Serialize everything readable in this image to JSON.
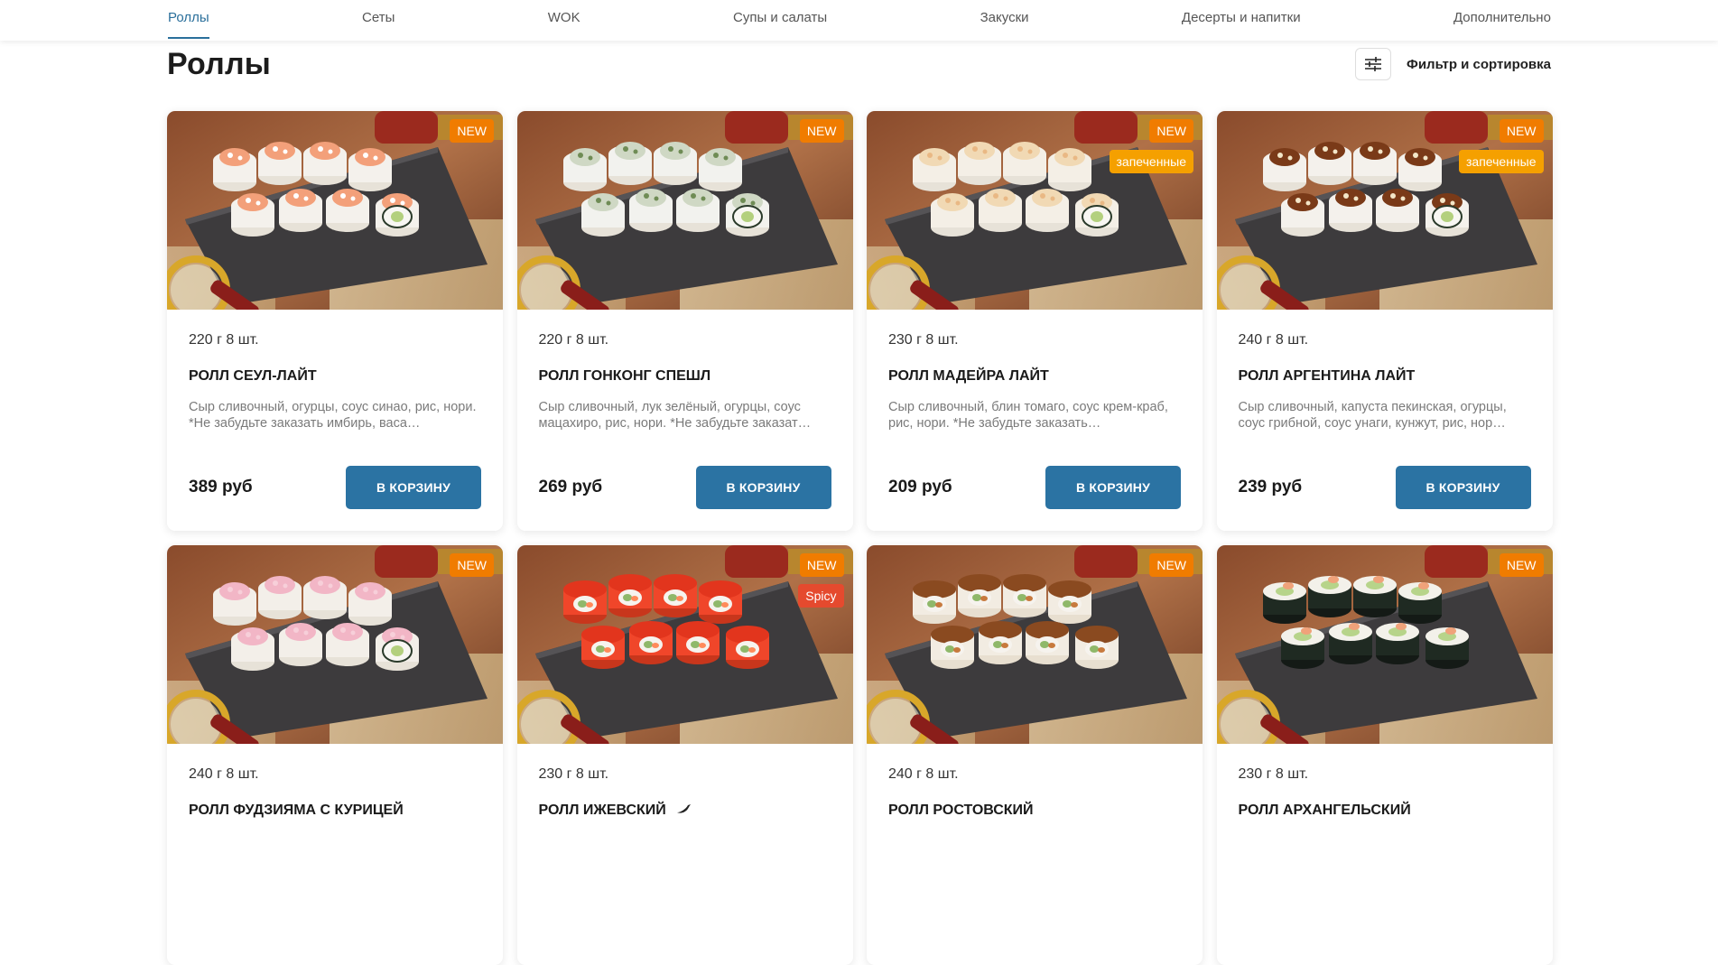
{
  "nav": {
    "items": [
      {
        "label": "Роллы",
        "active": true
      },
      {
        "label": "Сеты"
      },
      {
        "label": "WOK"
      },
      {
        "label": "Супы и салаты"
      },
      {
        "label": "Закуски"
      },
      {
        "label": "Десерты и напитки"
      },
      {
        "label": "Дополнительно"
      }
    ]
  },
  "page": {
    "title": "Роллы",
    "filter_label": "Фильтр и сортировка",
    "filter_icon": "sliders-icon"
  },
  "colors": {
    "accent": "#2b73a3",
    "badge_new": "#f07c00",
    "badge_baked": "#f5a000",
    "badge_spicy": "#e54a2e"
  },
  "products": [
    {
      "weight": "220 г 8 шт.",
      "name": "РОЛЛ СЕУЛ-ЛАЙТ",
      "desc": "Сыр сливочный, огурцы, соус синао, рис, нори. *Не забудьте заказать имбирь, васа…",
      "price": "389 руб",
      "button": "В КОРЗИНУ",
      "badges": [
        "NEW"
      ],
      "topping": "salmon"
    },
    {
      "weight": "220 г 8 шт.",
      "name": "РОЛЛ ГОНКОНГ СПЕШЛ",
      "desc": "Сыр сливочный, лук зелёный, огурцы, соус мацахиро, рис, нори. *Не забудьте заказат…",
      "price": "269 руб",
      "button": "В КОРЗИНУ",
      "badges": [
        "NEW"
      ],
      "topping": "green"
    },
    {
      "weight": "230 г 8 шт.",
      "name": "РОЛЛ МАДЕЙРА ЛАЙТ",
      "desc": "Сыр сливочный, блин томаго, соус крем-краб, рис, нори. *Не забудьте заказать…",
      "price": "209 руб",
      "button": "В КОРЗИНУ",
      "badges": [
        "NEW",
        "запеченные"
      ],
      "topping": "baked"
    },
    {
      "weight": "240 г 8 шт.",
      "name": "РОЛЛ АРГЕНТИНА ЛАЙТ",
      "desc": "Сыр сливочный, капуста пекинская, огурцы, соус грибной, соус унаги, кунжут, рис, нор…",
      "price": "239 руб",
      "button": "В КОРЗИНУ",
      "badges": [
        "NEW",
        "запеченные"
      ],
      "topping": "unagi"
    },
    {
      "weight": "240 г 8 шт.",
      "name": "РОЛЛ ФУДЗИЯМА С КУРИЦЕЙ",
      "desc": "",
      "price": "",
      "button": "",
      "badges": [
        "NEW"
      ],
      "topping": "pink"
    },
    {
      "weight": "230 г 8 шт.",
      "name": "РОЛЛ ИЖЕВСКИЙ",
      "spicy_icon": "chili-pepper-icon",
      "desc": "",
      "price": "",
      "button": "",
      "badges": [
        "NEW",
        "Spicy"
      ],
      "topping": "red"
    },
    {
      "weight": "240 г 8 шт.",
      "name": "РОЛЛ РОСТОВСКИЙ",
      "desc": "",
      "price": "",
      "button": "",
      "badges": [
        "NEW"
      ],
      "topping": "eel"
    },
    {
      "weight": "230 г 8 шт.",
      "name": "РОЛЛ АРХАНГЕЛЬСКИЙ",
      "desc": "",
      "price": "",
      "button": "",
      "badges": [
        "NEW"
      ],
      "topping": "nori"
    }
  ]
}
